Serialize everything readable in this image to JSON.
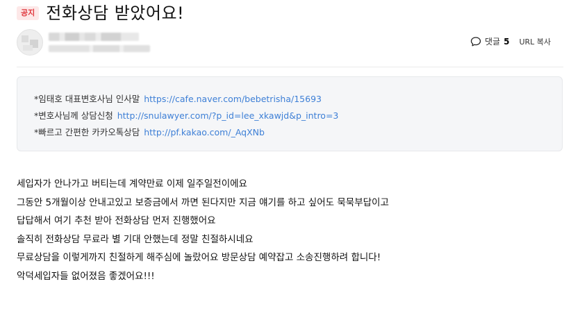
{
  "header": {
    "notice_badge": "공지",
    "title": "전화상담 받았어요!"
  },
  "toolbar": {
    "comment_label": "댓글",
    "comment_count": "5",
    "url_copy_label": "URL 복사"
  },
  "info_box": {
    "lines": [
      {
        "label": "*임태호 대표변호사님 인사말",
        "link": "https://cafe.naver.com/bebetrisha/15693"
      },
      {
        "label": "*변호사님께 상담신청",
        "link": "http://snulawyer.com/?p_id=lee_xkawjd&p_intro=3"
      },
      {
        "label": "*빠르고 간편한 카카오톡상담",
        "link": "http://pf.kakao.com/_AqXNb"
      }
    ]
  },
  "body": {
    "paragraphs": [
      "세입자가 안나가고 버티는데 계약만료 이제 일주일전이에요",
      "그동안 5개월이상 안내고있고 보증금에서 까면 된다지만 지금 얘기를 하고 싶어도 묵묵부답이고",
      "답답해서 여기 추천 받아 전화상담 먼저 진행했어요",
      "솔직히 전화상담 무료라 별 기대 안했는데 정말 친절하시네요",
      "무료상담을 이렇게까지 친절하게 해주심에 놀랐어요 방문상담 예약잡고 소송진행하려 합니다!",
      "악덕세입자들 없어졌음 좋겠어요!!!"
    ]
  },
  "colors": {
    "badge_bg": "#fde8e8",
    "badge_text": "#e0383e",
    "link": "#3d7fd6",
    "info_box_bg": "#f5f6f8"
  },
  "icons": {
    "comment": "speech-bubble-icon"
  }
}
